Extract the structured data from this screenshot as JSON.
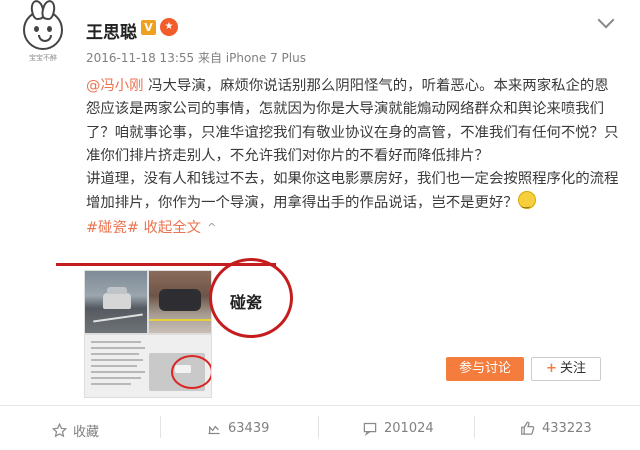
{
  "header": {
    "avatar_caption": "宝宝不醉",
    "username": "王思聪",
    "v_badge": "V",
    "medal_icon": "orange-medal-icon",
    "meta": "2016-11-18 13:55 来自 iPhone 7 Plus"
  },
  "post": {
    "mention": "@冯小刚",
    "para1": " 冯大导演，麻烦你说话别那么阴阳怪气的，听着恶心。本来两家私企的恩怨应该是两家公司的事情，怎就因为你是大导演就能煽动网络群众和舆论来喷我们了？咱就事论事，只准华谊挖我们有敬业协议在身的高管，不准我们有任何不悦？只准你们排片挤走别人，不允许我们对你片的不看好而降低排片？",
    "para2": "讲道理，没有人和钱过不去，如果你这电影票房好，我们也一定会按照程序化的流程增加排片，你作为一个导演，用拿得出手的作品说话，岂不是更好？",
    "topic": "#碰瓷#",
    "collapse": "收起全文",
    "caret": "^"
  },
  "topic_card": {
    "title": "碰瓷",
    "join_button": "参与讨论",
    "follow_button": "关注",
    "follow_plus": "+"
  },
  "footer": {
    "favorite": "收藏",
    "repost": "63439",
    "comment": "201024",
    "like": "433223"
  },
  "colors": {
    "accent": "#eb7350",
    "annotation_red": "#c51d1d",
    "button_orange": "#f47c3c"
  }
}
